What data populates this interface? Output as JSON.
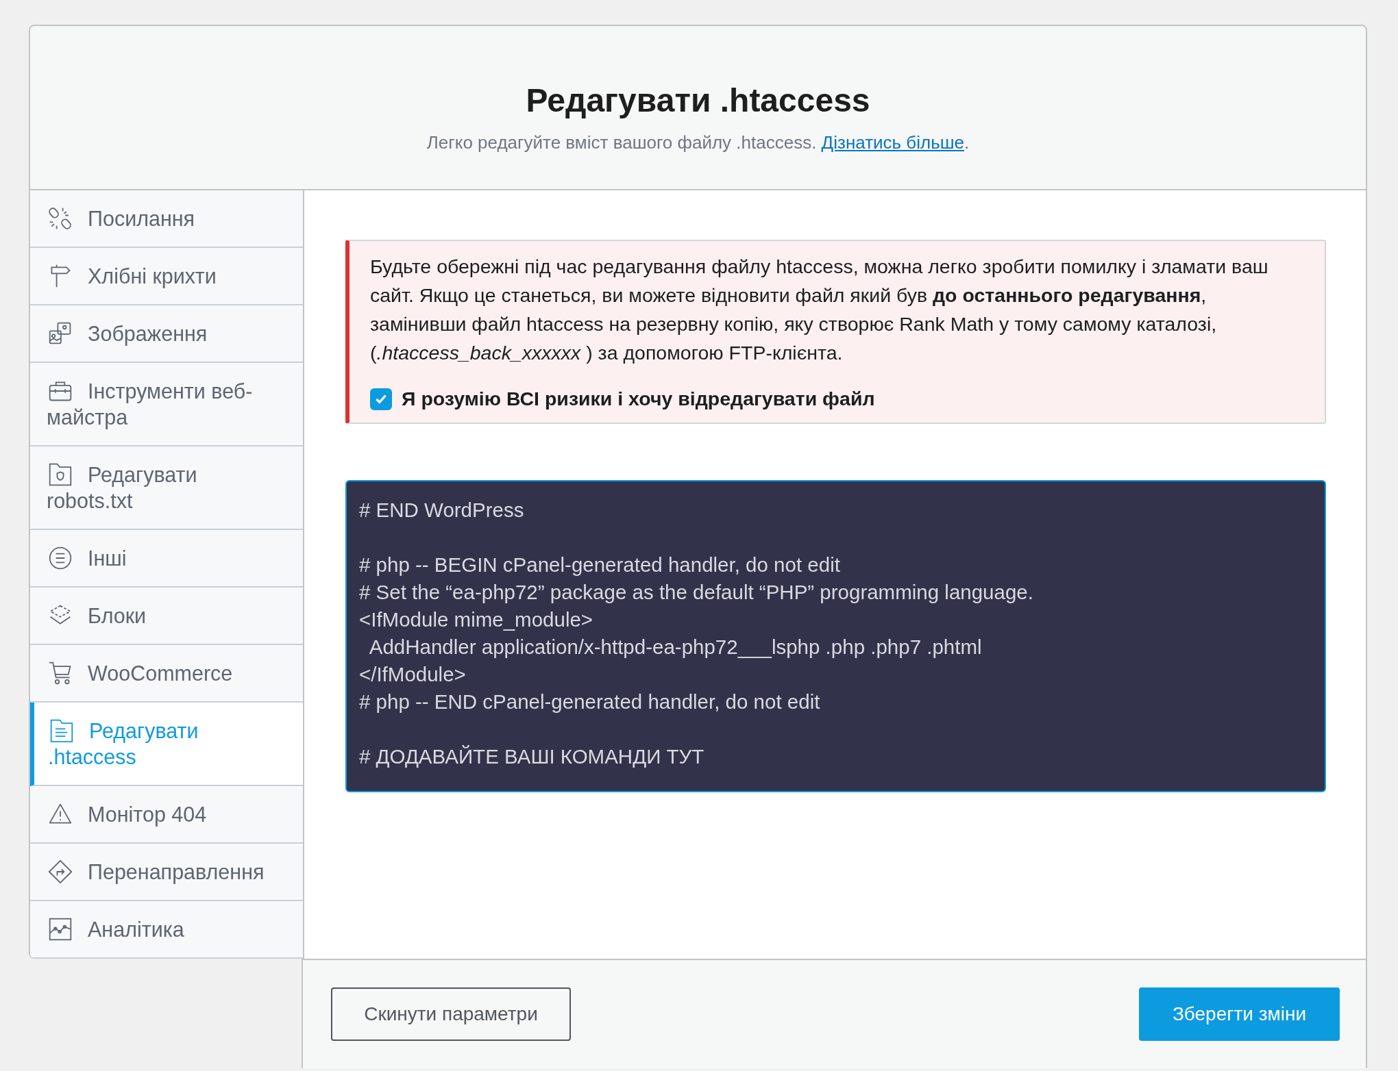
{
  "header": {
    "title": "Редагувати .htaccess",
    "subtitle": "Легко редагуйте вміст вашого файлу .htaccess. ",
    "link": "Дізнатись більше",
    "after_link": "."
  },
  "sidebar": {
    "items": [
      {
        "label": "Посилання",
        "selected": false
      },
      {
        "label": "Хлібні крихти",
        "selected": false
      },
      {
        "label": "Зображення",
        "selected": false
      },
      {
        "label": "Інструменти веб-майстра",
        "selected": false
      },
      {
        "label": "Редагувати robots.txt",
        "selected": false
      },
      {
        "label": "Інші",
        "selected": false
      },
      {
        "label": "Блоки",
        "selected": false
      },
      {
        "label": "WooCommerce",
        "selected": false
      },
      {
        "label": "Редагувати .htaccess",
        "selected": true
      },
      {
        "label": "Монітор 404",
        "selected": false
      },
      {
        "label": "Перенаправлення",
        "selected": false
      },
      {
        "label": "Аналітика",
        "selected": false
      }
    ]
  },
  "warning": {
    "text": "Будьте обережні під час редагування файлу htaccess, можна легко зробити помилку і зламати ваш сайт. Якщо це станеться, ви можете відновити файл який був **до останнього редагування**, замінивши файл htaccess на резервну копію, яку створює Rank Math у тому самому каталозі, (*.htaccess_back_xxxxxx* ) за допомогою FTP-клієнта.",
    "checkbox": {
      "label": "Я розумію ВСІ ризики і хочу відредагувати файл",
      "checked": true
    }
  },
  "editor": {
    "value": "# END WordPress\n\n# php -- BEGIN cPanel-generated handler, do not edit\n# Set the “ea-php72” package as the default “PHP” programming language.\n<IfModule mime_module>\n  AddHandler application/x-httpd-ea-php72___lsphp .php .php7 .phtml\n</IfModule>\n# php -- END cPanel-generated handler, do not edit\n\n# ДОДАВАЙТЕ ВАШІ КОМАНДИ ТУТ"
  },
  "footer": {
    "buttons": [
      {
        "label": "Скинути параметри",
        "kind": "secondary"
      },
      {
        "label": "Зберегти зміни",
        "kind": "primary"
      }
    ]
  }
}
